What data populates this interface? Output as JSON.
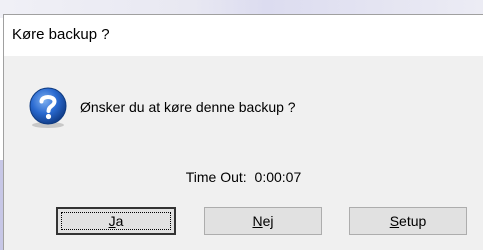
{
  "window": {
    "title": "Køre backup ?"
  },
  "dialog": {
    "icon": "question-icon",
    "message": "Ønsker du at køre denne backup ?",
    "timeout_label": "Time Out:",
    "timeout_value": "0:00:07"
  },
  "buttons": {
    "ja": {
      "accel": "J",
      "rest": "a"
    },
    "nej": {
      "accel": "N",
      "rest": "ej"
    },
    "setup": {
      "accel": "S",
      "rest": "etup"
    }
  },
  "colors": {
    "dialog_bg": "#f0f0f0",
    "titlebar_bg": "#ffffff",
    "icon_blue": "#1f5fbf",
    "button_bg": "#e1e1e1"
  }
}
